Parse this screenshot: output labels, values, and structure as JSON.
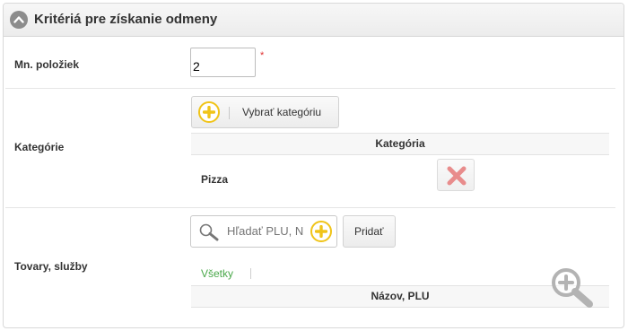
{
  "panel": {
    "title": "Kritériá pre získanie odmeny"
  },
  "fields": {
    "quantity": {
      "label": "Mn. položiek",
      "value": "2",
      "required_mark": "*"
    },
    "categories": {
      "label": "Kategórie",
      "select_button": "Vybrať kategóriu",
      "table_header": "Kategória",
      "rows": [
        {
          "name": "Pizza"
        }
      ]
    },
    "products": {
      "label": "Tovary, služby",
      "search_placeholder": "Hľadať PLU, N",
      "add_button": "Pridať",
      "filter_all": "Všetky",
      "table_header": "Názov, PLU"
    }
  },
  "icons": {
    "collapse": "chevron-up-icon",
    "add": "plus-circle-icon",
    "delete": "close-x-icon",
    "search": "magnifier-icon",
    "zoom": "zoom-in-icon"
  },
  "colors": {
    "accent_yellow": "#f0c419",
    "delete_red": "#e88c8c",
    "link_green": "#4aa84a",
    "required_red": "#e03030"
  }
}
